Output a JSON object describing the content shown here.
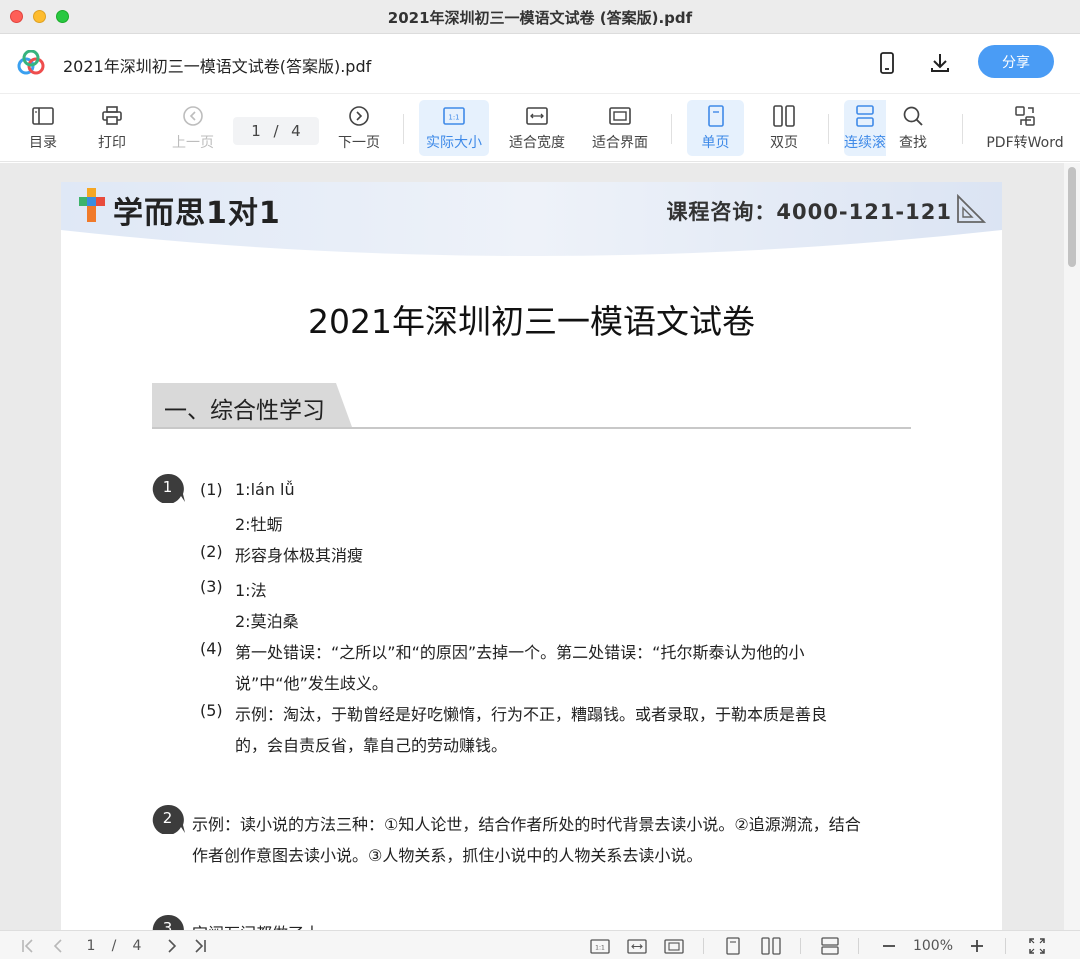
{
  "window": {
    "title": "2021年深圳初三一模语文试卷 (答案版).pdf"
  },
  "header": {
    "file_title": "2021年深圳初三一模语文试卷(答案版).pdf",
    "share_label": "分享",
    "accent_color": "#4a9cf5"
  },
  "toolbar": {
    "toc": "目录",
    "print": "打印",
    "prev": "上一页",
    "page_current": "1",
    "page_sep": "/",
    "page_total": "4",
    "next": "下一页",
    "actual_size": "实际大小",
    "fit_width": "适合宽度",
    "fit_window": "适合界面",
    "single": "单页",
    "double": "双页",
    "continuous": "连续滚",
    "find": "查找",
    "pdf_to_word": "PDF转Word"
  },
  "document": {
    "brand": "学而思1对1",
    "phone": "课程咨询：4000-121-121",
    "title": "2021年深圳初三一模语文试卷",
    "section": "一、综合性学习",
    "q1": {
      "badge": "1",
      "items": [
        {
          "num": "(1)",
          "lines": [
            "1:lán lǚ",
            "2:牡蛎"
          ]
        },
        {
          "num": "(2)",
          "lines": [
            "形容身体极其消瘦"
          ]
        },
        {
          "num": "(3)",
          "lines": [
            "1:法",
            "2:莫泊桑"
          ]
        },
        {
          "num": "(4)",
          "lines": [
            "第一处错误：“之所以”和“的原因”去掉一个。第二处错误：“托尔斯泰认为他的小",
            "说”中“他”发生歧义。"
          ]
        },
        {
          "num": "(5)",
          "lines": [
            "示例：淘汰，于勒曾经是好吃懒惰，行为不正，糟蹋钱。或者录取，于勒本质是善良",
            "的，会自责反省，靠自己的劳动赚钱。"
          ]
        }
      ]
    },
    "q2": {
      "badge": "2",
      "lines": [
        "示例：读小说的方法三种：①知人论世，结合作者所处的时代背景去读小说。②追源溯流，结合",
        "作者创作意图去读小说。③人物关系，抓住小说中的人物关系去读小说。"
      ]
    },
    "q3": {
      "badge": "3",
      "text": "宫阙万间都做了土"
    }
  },
  "statusbar": {
    "page_current": "1",
    "page_sep": "/",
    "page_total": "4",
    "zoom": "100%"
  }
}
